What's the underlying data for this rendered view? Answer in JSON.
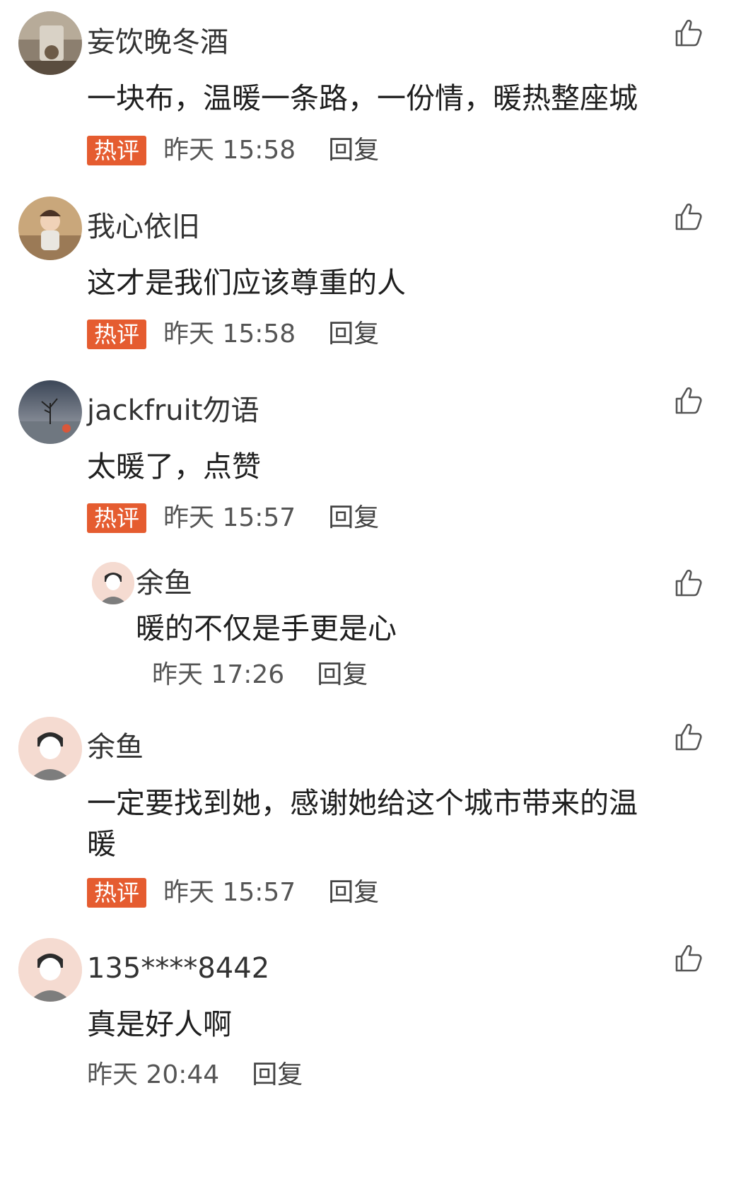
{
  "badge_hot": "热评",
  "reply_label": "回复",
  "comments": [
    {
      "user": "妄饮晚冬酒",
      "text": "一块布，温暖一条路，一份情，暖热整座城",
      "time": "昨天 15:58"
    },
    {
      "user": "我心依旧",
      "text": "这才是我们应该尊重的人",
      "time": "昨天 15:58"
    },
    {
      "user": "jackfruit勿语",
      "text": "太暖了，点赞",
      "time": "昨天 15:57"
    },
    {
      "user": "余鱼",
      "text": "暖的不仅是手更是心",
      "time": "昨天 17:26"
    },
    {
      "user": "余鱼",
      "text": "一定要找到她，感谢她给这个城市带来的温暖",
      "time": "昨天 15:57"
    },
    {
      "user": "135****8442",
      "text": "真是好人啊",
      "time": "昨天 20:44"
    }
  ],
  "icons": {
    "like": "thumbs-up-icon",
    "default_avatar": "default-avatar-icon"
  }
}
